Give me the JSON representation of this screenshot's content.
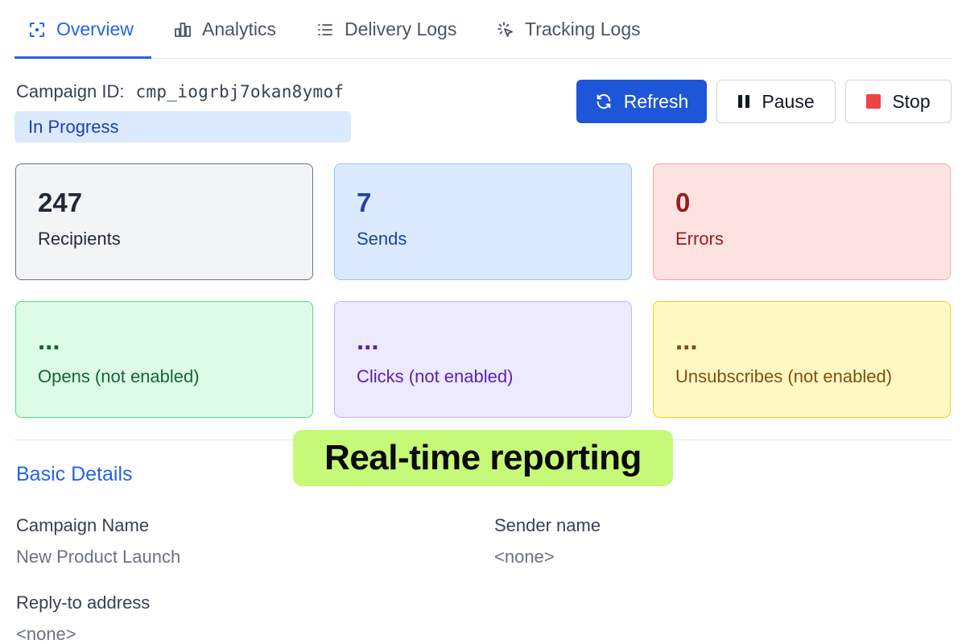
{
  "tabs": [
    {
      "label": "Overview",
      "icon": "overview-icon",
      "active": true
    },
    {
      "label": "Analytics",
      "icon": "bar-chart-icon",
      "active": false
    },
    {
      "label": "Delivery Logs",
      "icon": "list-icon",
      "active": false
    },
    {
      "label": "Tracking Logs",
      "icon": "click-cursor-icon",
      "active": false
    }
  ],
  "campaign": {
    "id_label": "Campaign ID:",
    "id_value": "cmp_iogrbj7okan8ymof",
    "status": "In Progress"
  },
  "actions": {
    "refresh": "Refresh",
    "pause": "Pause",
    "stop": "Stop"
  },
  "stats": [
    {
      "value": "247",
      "label": "Recipients"
    },
    {
      "value": "7",
      "label": "Sends"
    },
    {
      "value": "0",
      "label": "Errors"
    },
    {
      "value": "...",
      "label": "Opens (not enabled)"
    },
    {
      "value": "...",
      "label": "Clicks (not enabled)"
    },
    {
      "value": "...",
      "label": "Unsubscribes (not enabled)"
    }
  ],
  "promo": "Real-time reporting",
  "basic_details": {
    "title": "Basic Details",
    "campaign_name_label": "Campaign Name",
    "campaign_name_value": "New Product Launch",
    "sender_name_label": "Sender name",
    "sender_name_value": "<none>",
    "reply_to_label": "Reply-to address",
    "reply_to_value": "<none>"
  },
  "colors": {
    "accent": "#2563eb",
    "primary_button": "#1d56d8",
    "stop_square": "#ef4444",
    "promo_background": "#c5f977"
  }
}
